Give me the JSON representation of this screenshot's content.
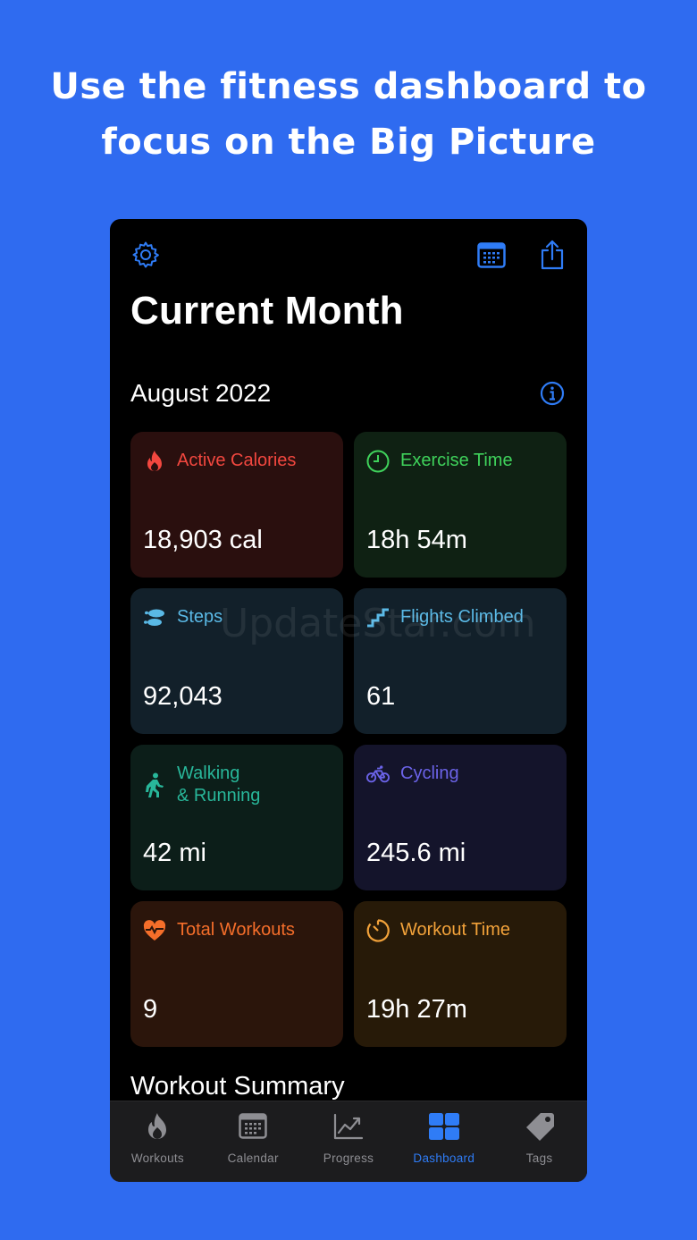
{
  "headline": {
    "line1": "Use the fitness dashboard to",
    "line2": "focus on the Big Picture"
  },
  "toolbar": {
    "settings_icon": "gear-icon",
    "calendar_icon": "calendar-icon",
    "share_icon": "share-icon"
  },
  "page": {
    "title": "Current Month",
    "month": "August 2022",
    "info_icon": "info-icon"
  },
  "colors": {
    "accent": "#2f7cf6",
    "background": "#2f6bf0",
    "calories": "#f2473f",
    "exercise": "#3fd25b",
    "steps": "#5ab9e6",
    "walking": "#28b79a",
    "cycling": "#6b63e8",
    "workouts": "#f56e2a",
    "workout_time": "#f2a23a"
  },
  "cards": [
    {
      "label": "Active Calories",
      "value": "18,903 cal",
      "icon": "flame-icon"
    },
    {
      "label": "Exercise Time",
      "value": "18h 54m",
      "icon": "clock-icon"
    },
    {
      "label": "Steps",
      "value": "92,043",
      "icon": "footprints-icon"
    },
    {
      "label": "Flights Climbed",
      "value": "61",
      "icon": "stairs-icon"
    },
    {
      "label": "Walking",
      "label2": "& Running",
      "value": "42 mi",
      "icon": "walking-figure-icon"
    },
    {
      "label": "Cycling",
      "value": "245.6 mi",
      "icon": "bicycle-icon"
    },
    {
      "label": "Total Workouts",
      "value": "9",
      "icon": "heart-pulse-icon"
    },
    {
      "label": "Workout Time",
      "value": "19h 27m",
      "icon": "timer-icon"
    }
  ],
  "section": {
    "summary_title": "Workout Summary"
  },
  "watermark": "UpdateStar.com",
  "tabs": [
    {
      "label": "Workouts",
      "icon": "flame-icon",
      "active": false
    },
    {
      "label": "Calendar",
      "icon": "calendar-icon",
      "active": false
    },
    {
      "label": "Progress",
      "icon": "chart-icon",
      "active": false
    },
    {
      "label": "Dashboard",
      "icon": "dashboard-grid-icon",
      "active": true
    },
    {
      "label": "Tags",
      "icon": "tag-icon",
      "active": false
    }
  ]
}
